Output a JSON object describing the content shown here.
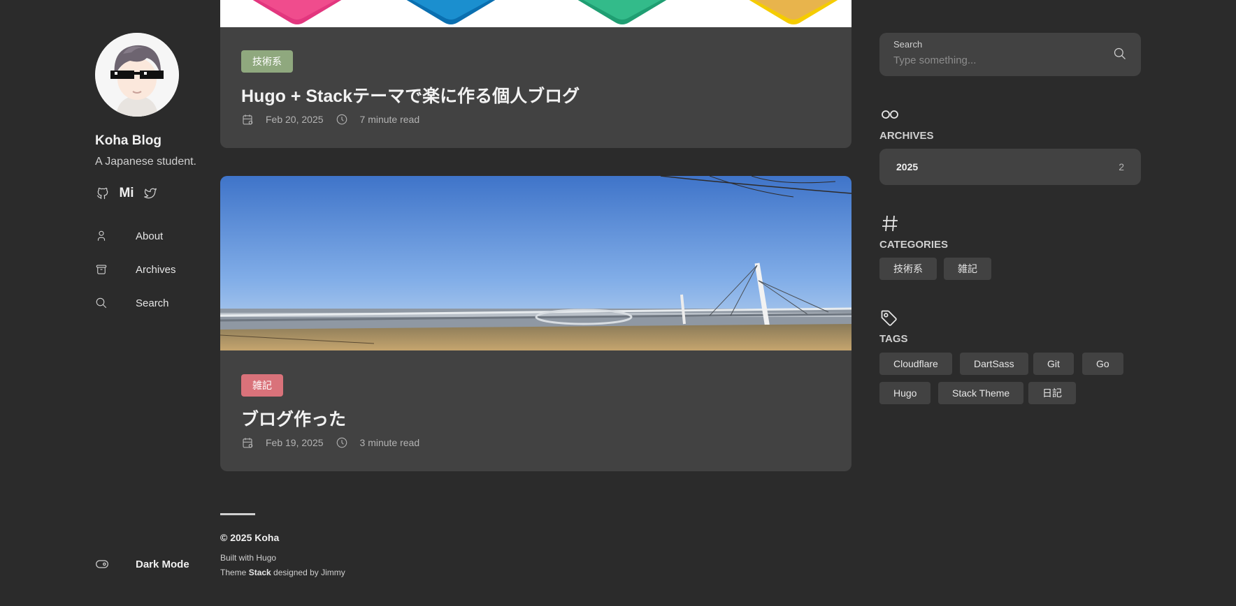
{
  "site": {
    "name": "Koha Blog",
    "description": "A Japanese student.",
    "social": [
      {
        "icon": "github-icon"
      },
      {
        "icon": "misskey-icon",
        "text": "Mi"
      },
      {
        "icon": "twitter-icon"
      }
    ]
  },
  "menu": [
    {
      "label": "About",
      "icon": "user-icon"
    },
    {
      "label": "Archives",
      "icon": "archive-icon"
    },
    {
      "label": "Search",
      "icon": "search-icon"
    }
  ],
  "dark_mode": {
    "label": "Dark Mode",
    "icon": "toggle-icon"
  },
  "posts": [
    {
      "category": "技術系",
      "category_color": "#8fa87e",
      "title": "Hugo + Stackテーマで楽に作る個人ブログ",
      "date": "Feb 20, 2025",
      "read_time": "7 minute read"
    },
    {
      "category": "雑記",
      "category_color": "#d9727a",
      "title": "ブログ作った",
      "date": "Feb 19, 2025",
      "read_time": "3 minute read"
    }
  ],
  "footer": {
    "copyright": "© 2025 Koha",
    "built_with": "Built with Hugo",
    "theme_prefix": "Theme ",
    "theme_name": "Stack",
    "theme_suffix": " designed by Jimmy"
  },
  "search": {
    "label": "Search",
    "placeholder": "Type something..."
  },
  "archives": {
    "title": "ARCHIVES",
    "items": [
      {
        "year": "2025",
        "count": "2"
      }
    ]
  },
  "categories": {
    "title": "CATEGORIES",
    "items": [
      "技術系",
      "雑記"
    ]
  },
  "tags": {
    "title": "TAGS",
    "items": [
      "Cloudflare",
      "DartSass",
      "Git",
      "Go",
      "Hugo",
      "Stack Theme",
      "日記"
    ]
  }
}
